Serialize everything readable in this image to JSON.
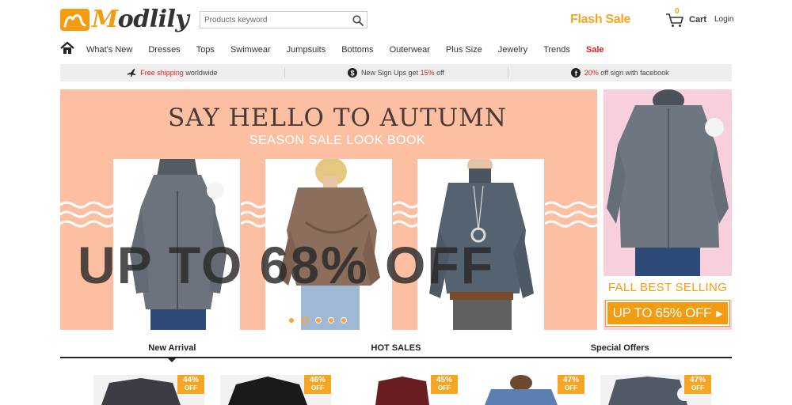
{
  "header": {
    "logo_text": "Modlily",
    "logo_text_accent": "M",
    "logo_text_rest": "odlily",
    "search_placeholder": "Products keyword",
    "flash_sale": "Flash Sale",
    "cart_count": "0",
    "cart_label": "Cart",
    "login_label": "Login"
  },
  "nav": {
    "items": [
      "What's New",
      "Dresses",
      "Tops",
      "Swimwear",
      "Jumpsuits",
      "Bottoms",
      "Outerwear",
      "Plus Size",
      "Jewelry",
      "Trends",
      "Sale"
    ]
  },
  "promo": {
    "shipping_red": "Free shipping",
    "shipping_rest": "worldwide",
    "signup_pre": "New Sign Ups get",
    "signup_red": "15%",
    "signup_post": "off",
    "facebook_red": "20%",
    "facebook_post": "off sign with facebook"
  },
  "hero": {
    "title": "SAY HELLO TO AUTUMN",
    "subtitle": "SEASON SALE LOOK BOOK",
    "offer": "UP TO 68% OFF"
  },
  "side_banner": {
    "label": "FALL BEST SELLING",
    "button_label": "UP TO 65% OFF",
    "button_arrow": "▶"
  },
  "tabs": [
    "New Arrival",
    "HOT SALES",
    "Special Offers"
  ],
  "products": [
    {
      "discount": "44%",
      "off": "OFF",
      "color": "#3a3d44"
    },
    {
      "discount": "46%",
      "off": "OFF",
      "color": "#1a1a1a"
    },
    {
      "discount": "45%",
      "off": "OFF",
      "color": "#6b1e22"
    },
    {
      "discount": "47%",
      "off": "OFF",
      "color": "#5a7fb0"
    },
    {
      "discount": "47%",
      "off": "OFF",
      "color": "#4f5a66"
    }
  ],
  "colors": {
    "brand": "#f39c12",
    "flash": "#f5a623",
    "sale": "#e02020",
    "hero_bg": "#fdbfa2",
    "side_bg": "#f8d0dd"
  },
  "icons": {
    "home": "home-icon",
    "search": "search-icon",
    "cart": "cart-icon",
    "plane": "plane-icon",
    "dollar": "dollar-icon",
    "facebook": "facebook-icon"
  }
}
